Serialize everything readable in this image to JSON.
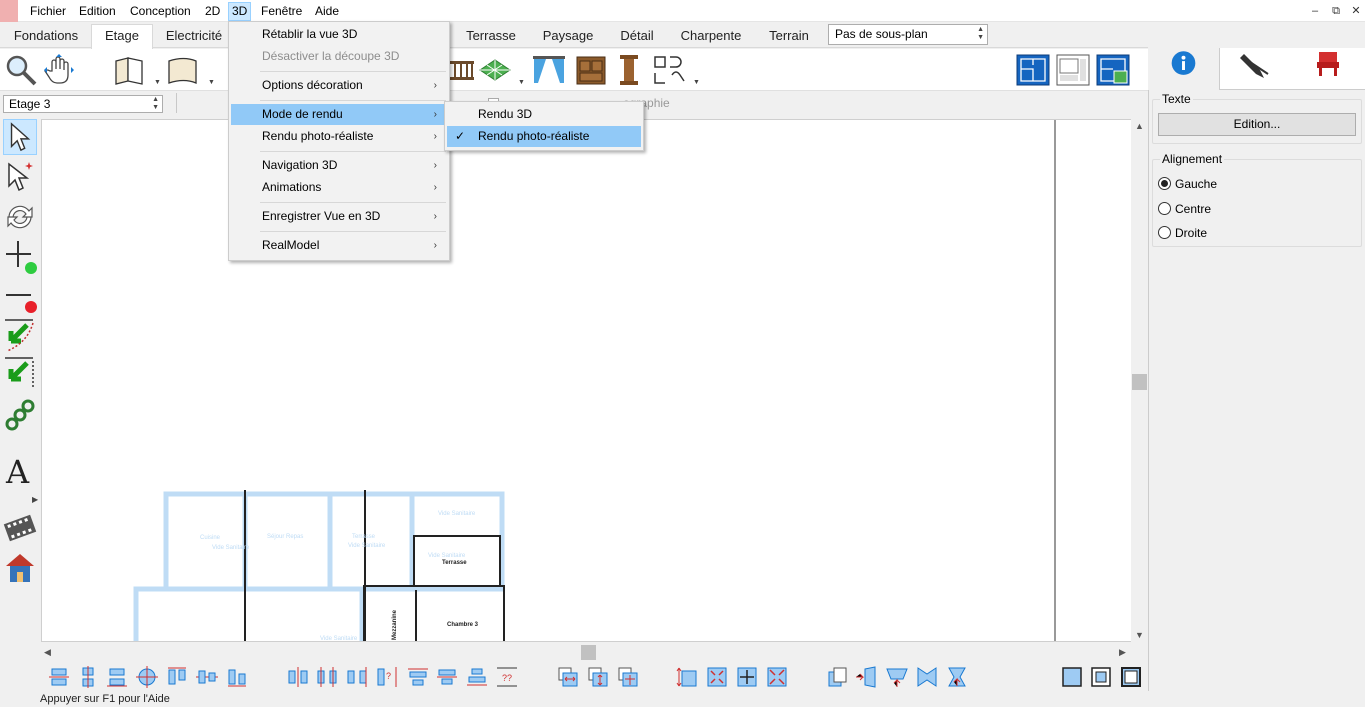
{
  "menubar": {
    "items": [
      "Fichier",
      "Edition",
      "Conception",
      "2D",
      "3D",
      "Fenêtre",
      "Aide"
    ],
    "active": "3D",
    "window_controls": [
      "–",
      "⧉",
      "✕"
    ]
  },
  "tabs": {
    "items": [
      "Fondations",
      "Etage",
      "Electricité",
      "Terrasse",
      "Paysage",
      "Détail",
      "Charpente",
      "Terrain"
    ],
    "selected": "Etage",
    "subplan_value": "Pas de sous-plan"
  },
  "optionbar": {
    "level_value": "Etage 3",
    "topography_label": "ographie"
  },
  "menu_3d": {
    "items": [
      {
        "label": "Rétablir la vue 3D",
        "enabled": true,
        "submenu": false
      },
      {
        "label": "Désactiver la découpe 3D",
        "enabled": false,
        "submenu": false
      },
      {
        "label": "Options décoration",
        "enabled": true,
        "submenu": true
      },
      {
        "label": "Mode de rendu",
        "enabled": true,
        "submenu": true,
        "highlighted": true
      },
      {
        "label": "Rendu photo-réaliste",
        "enabled": true,
        "submenu": true
      },
      {
        "label": "Navigation 3D",
        "enabled": true,
        "submenu": true
      },
      {
        "label": "Animations",
        "enabled": true,
        "submenu": true
      },
      {
        "label": "Enregistrer Vue en 3D",
        "enabled": true,
        "submenu": true
      },
      {
        "label": "RealModel",
        "enabled": true,
        "submenu": true
      }
    ]
  },
  "submenu_render": {
    "items": [
      {
        "label": "Rendu 3D",
        "checked": false
      },
      {
        "label": "Rendu photo-réaliste",
        "checked": true
      }
    ],
    "check_glyph": "✓"
  },
  "plan": {
    "rooms": [
      "Cuisine",
      "Vide Sanitaire",
      "Séjour Repas",
      "Terrasse",
      "Vide Sanitaire",
      "Vide Sanitaire",
      "Vide Sanitaire",
      "Terrasse",
      "Chambre 3",
      "Mezzanine",
      "Vide Sanitaire"
    ]
  },
  "right_panel": {
    "tabs": [
      "info-icon",
      "pen-icon",
      "chair-icon"
    ],
    "text_group_label": "Texte",
    "edit_button": "Edition...",
    "align_group_label": "Alignement",
    "align_options": [
      "Gauche",
      "Centre",
      "Droite"
    ],
    "align_selected": "Gauche"
  },
  "status": {
    "text": "Appuyer sur F1 pour l'Aide"
  },
  "colors": {
    "menu_highlight": "#91c9f7",
    "accent_blue": "#1979d1",
    "plan_wall_light": "#bfdcf5"
  }
}
